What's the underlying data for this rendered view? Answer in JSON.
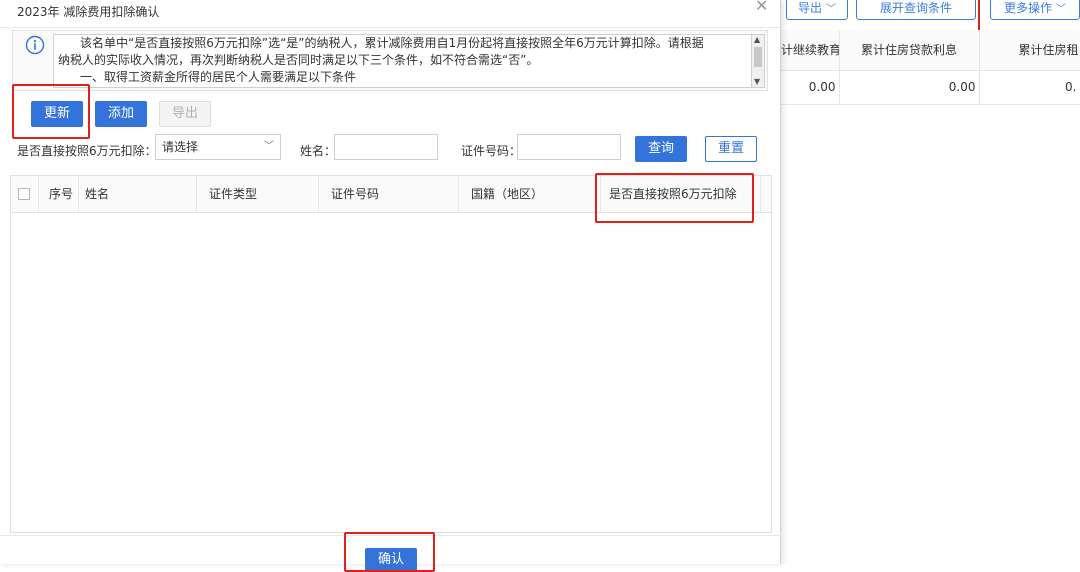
{
  "modal": {
    "title": "2023年 减除费用扣除确认",
    "close_glyph": "✕",
    "notice": {
      "line1": "该名单中“是否直接按照6万元扣除”选“是”的纳税人，累计减除费用自1月份起将直接按照全年6万元计算扣除。请根据",
      "line2": "纳税人的实际收入情况，再次判断纳税人是否同时满足以下三个条件，如不符合需选“否”。",
      "line3": "一、取得工资薪金所得的居民个人需要满足以下条件"
    },
    "buttons": {
      "update": "更新",
      "add": "添加",
      "export": "导出"
    },
    "filters": {
      "deduct_label": "是否直接按照6万元扣除：",
      "deduct_value": "请选择",
      "name_label": "姓名：",
      "name_value": "",
      "id_label": "证件号码：",
      "id_value": "",
      "query": "查询",
      "reset": "重置"
    },
    "table": {
      "columns": [
        "序号",
        "姓名",
        "证件类型",
        "证件号码",
        "国籍（地区）",
        "是否直接按照6万元扣除"
      ]
    },
    "confirm": "确认"
  },
  "background": {
    "buttons": {
      "export": "导出",
      "expand": "展开查询条件",
      "more": "更多操作"
    },
    "table": {
      "headers": [
        "计继续教育",
        "累计住房贷款利息",
        "累计住房租"
      ],
      "row": [
        "0.00",
        "0.00",
        "0."
      ]
    }
  }
}
